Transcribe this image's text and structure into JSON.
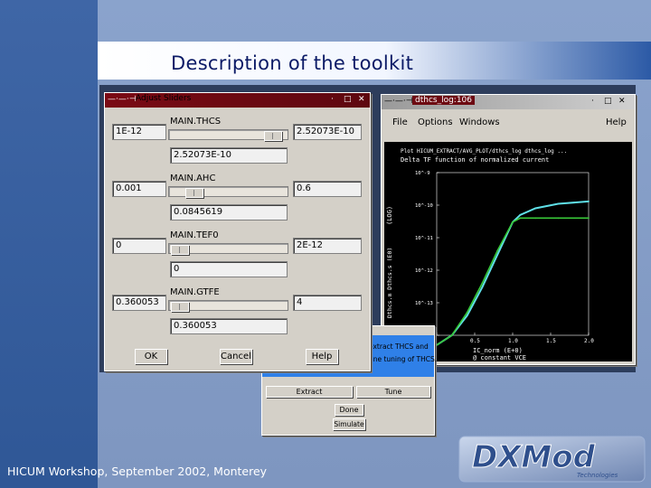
{
  "slide": {
    "title": "Description of the toolkit",
    "footer": "HICUM Workshop, September 2002, Monterey"
  },
  "sliders_window": {
    "title": "Adjust Sliders",
    "parameters": [
      {
        "name": "MAIN.THCS",
        "min": "1E-12",
        "max": "2.52073E-10",
        "value": "2.52073E-10",
        "position": 0.95
      },
      {
        "name": "MAIN.AHC",
        "min": "0.001",
        "max": "0.6",
        "value": "0.0845619",
        "position": 0.16
      },
      {
        "name": "MAIN.TEF0",
        "min": "0",
        "max": "2E-12",
        "value": "0",
        "position": 0.02
      },
      {
        "name": "MAIN.GTFE",
        "min": "0.360053",
        "max": "4",
        "value": "0.360053",
        "position": 0.02
      }
    ],
    "buttons": {
      "ok": "OK",
      "cancel": "Cancel",
      "help": "Help"
    }
  },
  "plot_window": {
    "title": "dthcs_log:106",
    "menus": [
      "File",
      "Options",
      "Windows"
    ],
    "help": "Help",
    "plot_title_line1": "Plot HICUM_EXTRACT/AVG_PLOT/dthcs_log dthcs_log ...",
    "plot_title_line2": "Delta TF function of normalized current",
    "xlabel": "IC_norm (E+0)",
    "xlabel2": "@ constant VCE",
    "ylabel_left": "Dthcs.m Dthcs.s (E0)",
    "ylabel_right": "(LOG)",
    "x_ticks": [
      "0",
      "0.5",
      "1.0",
      "1.5",
      "2.0"
    ],
    "y_ticks": [
      "10^-9",
      "10^-10",
      "10^-11",
      "10^-12",
      "10^-13",
      "10^-14"
    ]
  },
  "extract_dialog": {
    "text_line1": "extract THCS and",
    "text_line2": "fine tuning of THCS.",
    "buttons": {
      "extract": "Extract",
      "tune": "Tune",
      "done": "Done",
      "simulate": "Simulate"
    }
  },
  "logo": {
    "text": "DXMod",
    "subtitle": "Technologies"
  },
  "chart_data": {
    "type": "line",
    "title": "Delta TF function of normalized current",
    "xlabel": "IC_norm (E+0)",
    "ylabel": "Dthcs.m Dthcs.s (E0)",
    "xlim": [
      0,
      2.0
    ],
    "yscale": "log",
    "ylim": [
      1e-14,
      1e-09
    ],
    "series": [
      {
        "color": "#5fe0e8",
        "x": [
          0.0,
          0.2,
          0.4,
          0.6,
          0.8,
          1.0,
          1.1,
          1.3,
          1.6,
          2.0
        ],
        "values": [
          5e-15,
          1e-14,
          4e-14,
          3e-13,
          3e-12,
          3e-11,
          5e-11,
          8e-11,
          1.1e-10,
          1.3e-10
        ]
      },
      {
        "color": "#38c838",
        "x": [
          0.0,
          0.2,
          0.4,
          0.6,
          0.8,
          1.0,
          1.1,
          1.3,
          1.6,
          2.0
        ],
        "values": [
          5e-15,
          1e-14,
          5e-14,
          4e-13,
          4e-12,
          3e-11,
          4e-11,
          4e-11,
          4e-11,
          4e-11
        ]
      }
    ]
  }
}
